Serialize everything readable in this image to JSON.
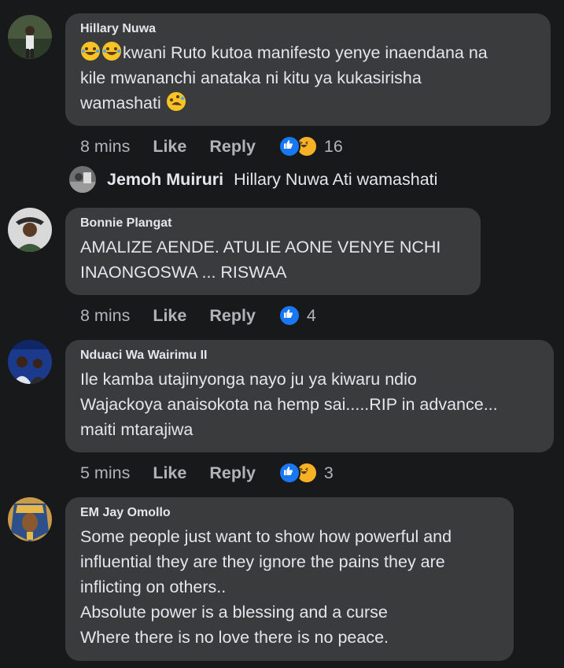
{
  "comments": [
    {
      "author": "Hillary Nuwa",
      "text": "kwani Ruto kutoa manifesto yenye inaendana na\nkile mwananchi anataka ni kitu ya kukasirisha\nwamashati",
      "time": "8 mins",
      "like_label": "Like",
      "reply_label": "Reply",
      "reaction_count": "16",
      "reactions": [
        "like-icon",
        "haha-icon"
      ]
    },
    {
      "author": "Bonnie Plangat",
      "text": "AMALIZE AENDE. ATULIE AONE VENYE NCHI\nINAONGOSWA ... RISWAA",
      "time": "8 mins",
      "like_label": "Like",
      "reply_label": "Reply",
      "reaction_count": "4",
      "reactions": [
        "like-icon"
      ]
    },
    {
      "author": "Nduaci Wa Wairimu II",
      "text": "Ile kamba utajinyonga nayo ju ya kiwaru ndio\nWajackoya anaisokota na hemp sai.....RIP in advance...\nmaiti mtarajiwa",
      "time": "5 mins",
      "like_label": "Like",
      "reply_label": "Reply",
      "reaction_count": "3",
      "reactions": [
        "like-icon",
        "haha-icon"
      ]
    },
    {
      "author": "EM Jay Omollo",
      "text": "Some people just want to show how powerful and\ninfluential they are they ignore the pains they are\ninflicting on others..\nAbsolute power is a blessing and a curse\nWhere there is no love there is no peace."
    }
  ],
  "reply": {
    "author": "Jemoh Muiruri",
    "text": "Hillary Nuwa Ati wamashati"
  },
  "colors": {
    "background": "#18191a",
    "bubble": "#3a3b3c",
    "text": "#e4e6eb",
    "meta": "#b0b3b8",
    "like_blue": "#1877f2",
    "haha_yellow": "#f7b125"
  }
}
